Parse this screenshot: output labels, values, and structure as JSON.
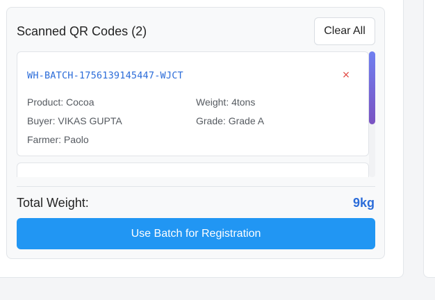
{
  "panel": {
    "title": "Scanned QR Codes (2)",
    "clear_all_label": "Clear All"
  },
  "qr_items": [
    {
      "batch_id": "WH-BATCH-1756139145447-WJCT",
      "remove_icon": "×",
      "product": "Product: Cocoa",
      "weight": "Weight: 4tons",
      "buyer": "Buyer: VIKAS GUPTA",
      "grade": "Grade: Grade A",
      "farmer": "Farmer: Paolo"
    }
  ],
  "summary": {
    "total_label": "Total Weight:",
    "total_value": "9kg"
  },
  "actions": {
    "use_batch_label": "Use Batch for Registration"
  },
  "colors": {
    "accent": "#2196f3",
    "batch_id": "#2b6cd9",
    "remove": "#e0413b"
  }
}
